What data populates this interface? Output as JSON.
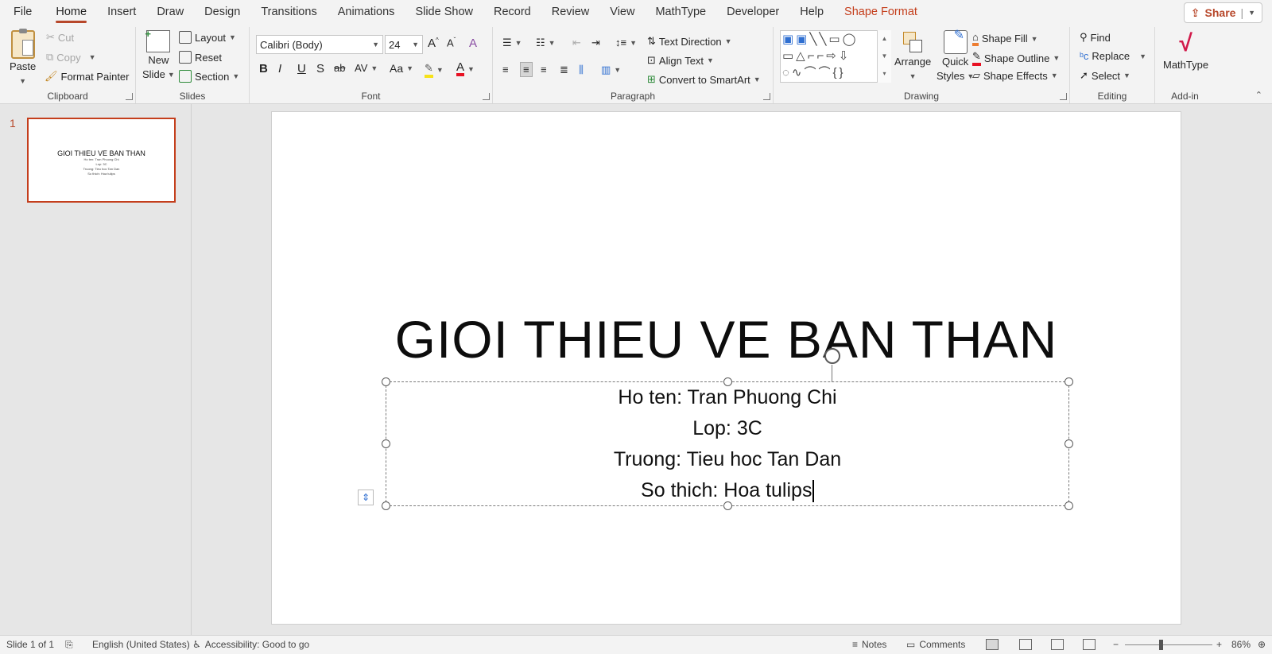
{
  "tabs": [
    "File",
    "Home",
    "Insert",
    "Draw",
    "Design",
    "Transitions",
    "Animations",
    "Slide Show",
    "Record",
    "Review",
    "View",
    "MathType",
    "Developer",
    "Help",
    "Shape Format"
  ],
  "share": {
    "label": "Share"
  },
  "clipboard": {
    "paste": "Paste",
    "cut": "Cut",
    "copy": "Copy",
    "format_painter": "Format Painter",
    "label": "Clipboard"
  },
  "slides_group": {
    "new_slide_1": "New",
    "new_slide_2": "Slide",
    "layout": "Layout",
    "reset": "Reset",
    "section": "Section",
    "label": "Slides"
  },
  "font": {
    "name": "Calibri (Body)",
    "size": "24",
    "bold": "B",
    "italic": "I",
    "underline": "U",
    "shadow": "S",
    "strike": "ab",
    "spacing": "AV",
    "case": "Aa",
    "color_letter": "A",
    "label": "Font"
  },
  "paragraph": {
    "text_direction": "Text Direction",
    "align_text": "Align Text",
    "smartart": "Convert to SmartArt",
    "label": "Paragraph"
  },
  "drawing": {
    "arrange": "Arrange",
    "quick_styles_1": "Quick",
    "quick_styles_2": "Styles",
    "shape_fill": "Shape Fill",
    "shape_outline": "Shape Outline",
    "shape_effects": "Shape Effects",
    "label": "Drawing"
  },
  "editing": {
    "find": "Find",
    "replace": "Replace",
    "select": "Select",
    "label": "Editing"
  },
  "addin": {
    "mathtype": "MathType",
    "label": "Add-in"
  },
  "thumbnail": {
    "number": "1",
    "title": "GIOI THIEU VE BAN THAN",
    "lines": [
      "Ho ten: Tran Phuong Chi",
      "Lop: 3C",
      "Truong: Tieu hoc Tan Dan",
      "So thich: Hoa tulips"
    ]
  },
  "slide": {
    "title": "GIOI THIEU VE BAN THAN",
    "lines": [
      "Ho ten: Tran Phuong Chi",
      "Lop: 3C",
      "Truong: Tieu hoc Tan Dan",
      "So thich: Hoa tulips"
    ]
  },
  "status": {
    "slide": "Slide 1 of 1",
    "language": "English (United States)",
    "accessibility": "Accessibility: Good to go",
    "notes": "Notes",
    "comments": "Comments",
    "zoom": "86%"
  },
  "colors": {
    "accent": "#b7472a",
    "contextual": "#c43e1c"
  }
}
